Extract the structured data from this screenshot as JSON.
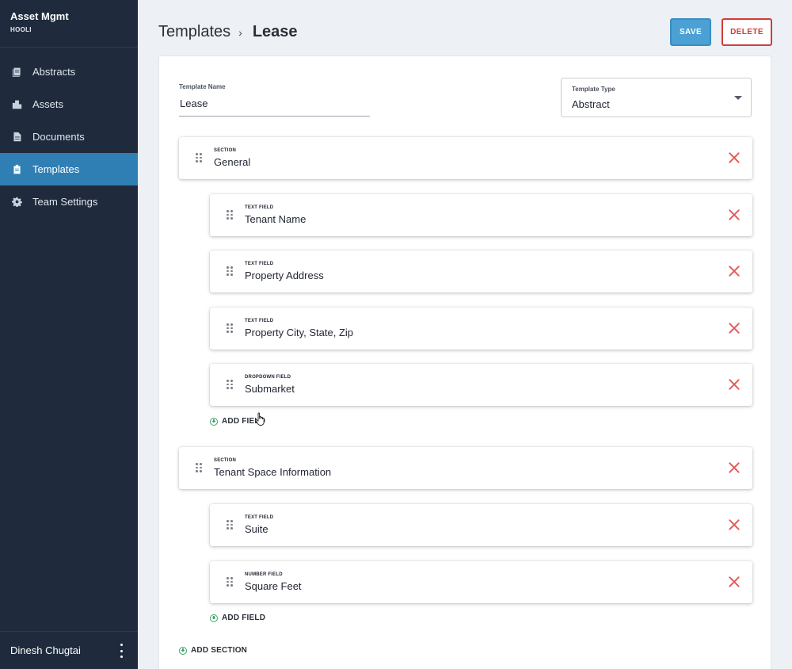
{
  "sidebar": {
    "app_title": "Asset Mgmt",
    "org": "HOOLI",
    "items": [
      {
        "label": "Abstracts",
        "icon": "book-stack-icon"
      },
      {
        "label": "Assets",
        "icon": "building-icon"
      },
      {
        "label": "Documents",
        "icon": "document-icon"
      },
      {
        "label": "Templates",
        "icon": "clipboard-icon",
        "active": true
      },
      {
        "label": "Team Settings",
        "icon": "gear-icon"
      }
    ],
    "user": "Dinesh Chugtai"
  },
  "header": {
    "breadcrumb_parent": "Templates",
    "breadcrumb_separator": "›",
    "breadcrumb_current": "Lease",
    "save_label": "SAVE",
    "delete_label": "DELETE"
  },
  "form": {
    "name_label": "Template Name",
    "name_value": "Lease",
    "type_label": "Template Type",
    "type_value": "Abstract"
  },
  "sections": [
    {
      "type": "SECTION",
      "label": "General",
      "fields": [
        {
          "type": "TEXT FIELD",
          "label": "Tenant Name"
        },
        {
          "type": "TEXT FIELD",
          "label": "Property Address"
        },
        {
          "type": "TEXT FIELD",
          "label": "Property City, State, Zip"
        },
        {
          "type": "DROPDOWN FIELD",
          "label": "Submarket"
        }
      ],
      "add_field_label": "ADD FIELD"
    },
    {
      "type": "SECTION",
      "label": "Tenant Space Information",
      "fields": [
        {
          "type": "TEXT FIELD",
          "label": "Suite"
        },
        {
          "type": "NUMBER FIELD",
          "label": "Square Feet"
        }
      ],
      "add_field_label": "ADD FIELD"
    }
  ],
  "add_section_label": "ADD SECTION",
  "colors": {
    "sidebar_bg": "#1f2b3d",
    "active_nav": "#2f7fb5",
    "save_button": "#4ba1d3",
    "delete_accent": "#d23a3a",
    "remove_icon": "#e45b5b",
    "add_icon": "#38a56a"
  }
}
